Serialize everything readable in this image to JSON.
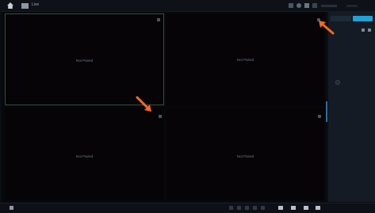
{
  "app": {
    "title": "Live"
  },
  "panes": [
    {
      "label": "Not Paired"
    },
    {
      "label": "Not Paired"
    },
    {
      "label": "Not Paired"
    },
    {
      "label": "Not Paired"
    }
  ],
  "colors": {
    "accent": "#23a1d6",
    "annotation_arrow": "#f26a21"
  },
  "icons": [
    "home-icon",
    "live-view-icon",
    "close-icon",
    "add-icon",
    "layout-icon",
    "fullscreen-icon",
    "arrow-annotation"
  ]
}
